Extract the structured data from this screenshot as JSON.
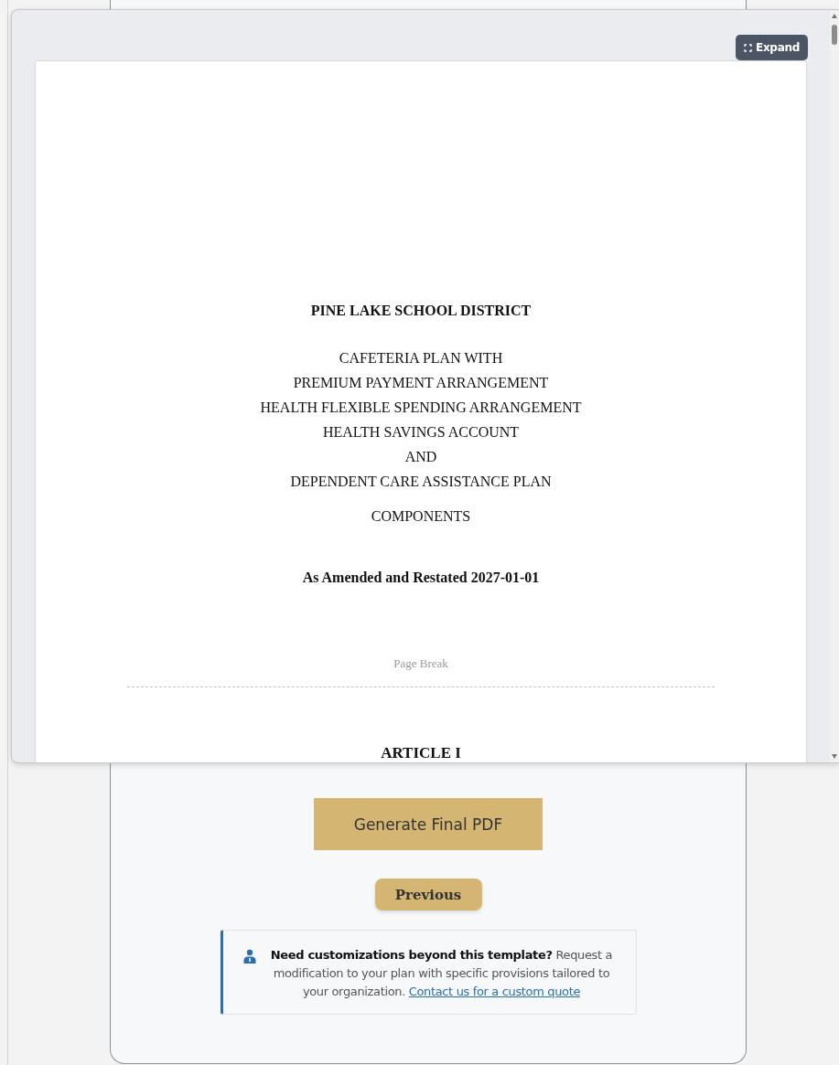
{
  "preview": {
    "expand_button": "Expand",
    "document": {
      "title": "PINE LAKE SCHOOL DISTRICT",
      "plan_lines": [
        "CAFETERIA PLAN WITH",
        "PREMIUM PAYMENT ARRANGEMENT",
        "HEALTH FLEXIBLE SPENDING ARRANGEMENT",
        "HEALTH SAVINGS ACCOUNT",
        "AND",
        "DEPENDENT CARE ASSISTANCE PLAN"
      ],
      "components_line": "COMPONENTS",
      "restated": "As Amended and Restated 2027-01-01",
      "page_break": "Page Break",
      "next_heading": "ARTICLE I"
    }
  },
  "actions": {
    "primary_button": "Generate Final PDF",
    "secondary_button": "Previous"
  },
  "note": {
    "text": "**Need customizations beyond this template?** Request a modification to your plan with specific provisions tailored to your organization.",
    "link": "Contact us for a custom quote"
  }
}
